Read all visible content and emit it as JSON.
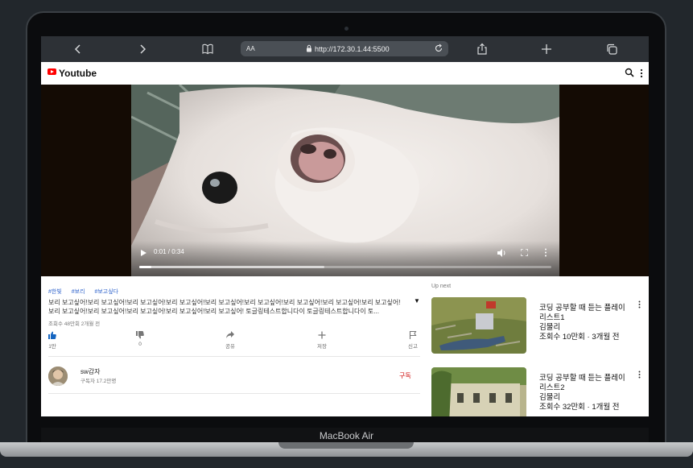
{
  "device": {
    "brand": "MacBook Air"
  },
  "browser": {
    "text_size_label": "AA",
    "url": "http://172.30.1.44:5500",
    "icons": [
      "chevron-left-icon",
      "chevron-right-icon",
      "book-icon",
      "lock-icon",
      "reload-icon",
      "share-icon",
      "plus-icon",
      "tabs-icon"
    ]
  },
  "app": {
    "title": "Youtube",
    "accent": "#ff0000"
  },
  "player": {
    "time": "0:01 / 0:34",
    "progress_fraction": 0.03,
    "buffered_fraction": 0.45
  },
  "video": {
    "tags": [
      "#한빛",
      "#보리",
      "#보고싶다"
    ],
    "description": "보리 보고싶어!보리 보고싶어!보리 보고싶어!보리 보고싶어!보리 보고싶어!보리 보고싶어!보리 보고싶어!보리 보고싶어!보리 보고싶어! 보리 보고싶어!보리 보고싶어!보리 보고싶어!보리 보고싶어!보리 보고싶어! 토글링테스트합니다이 토글링테스트합니다이 토...",
    "meta": "조회수 48만회 2개월 전",
    "actions": [
      {
        "icon": "thumbs-up-icon",
        "label": "1만"
      },
      {
        "icon": "thumbs-down-icon",
        "label": "0"
      },
      {
        "icon": "share-icon",
        "label": "공유"
      },
      {
        "icon": "plus-icon",
        "label": "저장"
      },
      {
        "icon": "flag-icon",
        "label": "신고"
      }
    ]
  },
  "channel": {
    "name": "sw감자",
    "subscribers": "구독자 17.2만명",
    "subscribe_label": "구독"
  },
  "upnext": {
    "title": "Up next",
    "items": [
      {
        "title": "코딩 공부할 때 듣는 플레이리스트1",
        "channel": "김물리",
        "stats": "조회수 10만회 · 3개월 전"
      },
      {
        "title": "코딩 공부할 때 듣는 플레이리스트2",
        "channel": "김물리",
        "stats": "조회수 32만회 · 1개월 전"
      }
    ]
  }
}
